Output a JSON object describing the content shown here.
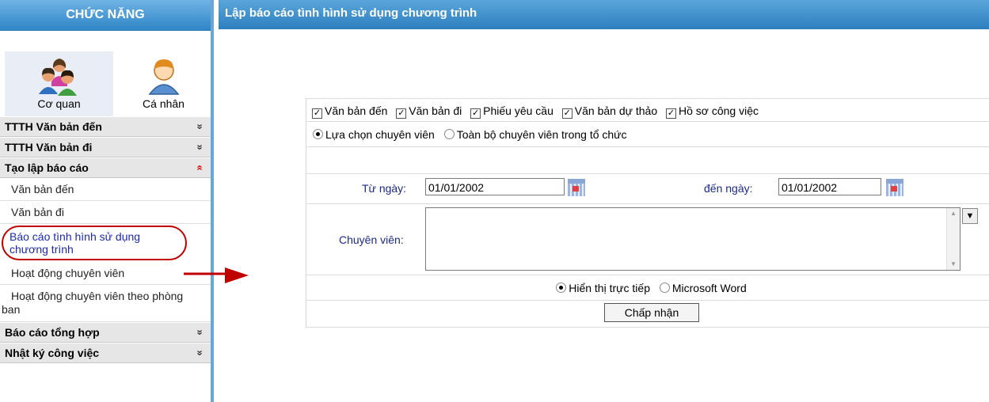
{
  "sidebar": {
    "header": "CHỨC NĂNG",
    "icons": [
      {
        "label": "Cơ quan",
        "icon": "group-people-icon"
      },
      {
        "label": "Cá nhân",
        "icon": "person-icon"
      }
    ],
    "sections": [
      {
        "label": "TTTH Văn bản đến",
        "chev": "»"
      },
      {
        "label": "TTTH Văn bản đi",
        "chev": "»"
      },
      {
        "label": "Tạo lập báo cáo",
        "chev": "«"
      },
      {
        "label": "Báo cáo tổng hợp",
        "chev": "»"
      },
      {
        "label": "Nhật ký công việc",
        "chev": "»"
      }
    ],
    "items": [
      {
        "label": "Văn bản đến"
      },
      {
        "label": "Văn bản đi"
      },
      {
        "label": "Báo cáo tình hình sử dụng chương trình"
      },
      {
        "label": "Hoạt động chuyên viên"
      },
      {
        "label": "Hoạt động chuyên viên theo phòng ban"
      }
    ]
  },
  "title": "Lập báo cáo tình hình sử dụng chương trình",
  "form": {
    "checkboxes": [
      {
        "label": "Văn bản đến",
        "checked": true
      },
      {
        "label": "Văn bản đi",
        "checked": true
      },
      {
        "label": "Phiếu yêu cầu",
        "checked": true
      },
      {
        "label": "Văn bản dự thảo",
        "checked": true
      },
      {
        "label": "Hồ sơ công việc",
        "checked": true
      }
    ],
    "scope_radios": [
      {
        "label": "Lựa chọn chuyên viên",
        "selected": true
      },
      {
        "label": "Toàn bộ chuyên viên trong tổ chức",
        "selected": false
      }
    ],
    "from_label": "Từ ngày:",
    "from_value": "01/01/2002",
    "to_label": "đến ngày:",
    "to_value": "01/01/2002",
    "specialist_label": "Chuyên viên:",
    "output_radios": [
      {
        "label": "Hiển thị trực tiếp",
        "selected": true
      },
      {
        "label": "Microsoft Word",
        "selected": false
      }
    ],
    "submit_label": "Chấp nhận"
  },
  "colors": {
    "accent": "#2d7fbe",
    "highlight": "#c00000"
  }
}
